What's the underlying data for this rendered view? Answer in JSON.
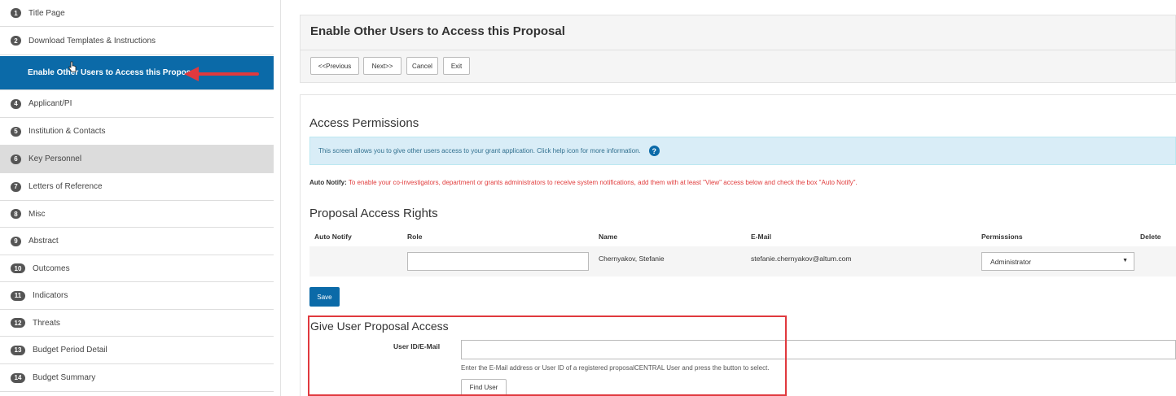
{
  "sidebar": {
    "items": [
      {
        "num": "1",
        "label": "Title Page",
        "state": "normal"
      },
      {
        "num": "2",
        "label": "Download Templates & Instructions",
        "state": "normal"
      },
      {
        "num": "",
        "label": "Enable Other Users to Access this Proposal",
        "state": "active"
      },
      {
        "num": "4",
        "label": "Applicant/PI",
        "state": "normal"
      },
      {
        "num": "5",
        "label": "Institution & Contacts",
        "state": "normal"
      },
      {
        "num": "6",
        "label": "Key Personnel",
        "state": "gray"
      },
      {
        "num": "7",
        "label": "Letters of Reference",
        "state": "normal"
      },
      {
        "num": "8",
        "label": "Misc",
        "state": "normal"
      },
      {
        "num": "9",
        "label": "Abstract",
        "state": "normal"
      },
      {
        "num": "10",
        "label": "Outcomes",
        "state": "normal"
      },
      {
        "num": "11",
        "label": "Indicators",
        "state": "normal"
      },
      {
        "num": "12",
        "label": "Threats",
        "state": "normal"
      },
      {
        "num": "13",
        "label": "Budget Period Detail",
        "state": "normal"
      },
      {
        "num": "14",
        "label": "Budget Summary",
        "state": "normal"
      }
    ]
  },
  "header": {
    "title": "Enable Other Users to Access this Proposal",
    "buttons": {
      "previous": "<<Previous",
      "next": "Next>>",
      "cancel": "Cancel",
      "exit": "Exit"
    }
  },
  "access": {
    "heading": "Access Permissions",
    "info": "This screen allows you to give other users access to your grant application. Click help icon for more information.",
    "auto_notify_label": "Auto Notify:",
    "auto_notify_text": "To enable your co-investigators, department or grants administrators to receive system notifications, add them with at least \"View\" access below and check the box \"Auto Notify\"."
  },
  "rights": {
    "heading": "Proposal Access Rights",
    "columns": {
      "auto_notify": "Auto Notify",
      "role": "Role",
      "name": "Name",
      "email": "E-Mail",
      "permissions": "Permissions",
      "delete": "Delete"
    },
    "row": {
      "role": "",
      "name": "Chernyakov, Stefanie",
      "email": "stefanie.chernyakov@altum.com",
      "permission": "Administrator"
    },
    "save_label": "Save"
  },
  "give_access": {
    "heading": "Give User Proposal Access",
    "user_label": "User ID/E-Mail",
    "user_value": "",
    "help": "Enter the E-Mail address or User ID of a registered proposalCENTRAL User and press the button to select.",
    "find_label": "Find User"
  },
  "colors": {
    "accent": "#0b6aa8",
    "annotation_red": "#e0393e",
    "info_bg": "#d9edf7",
    "warning_text": "#e03b3b"
  }
}
